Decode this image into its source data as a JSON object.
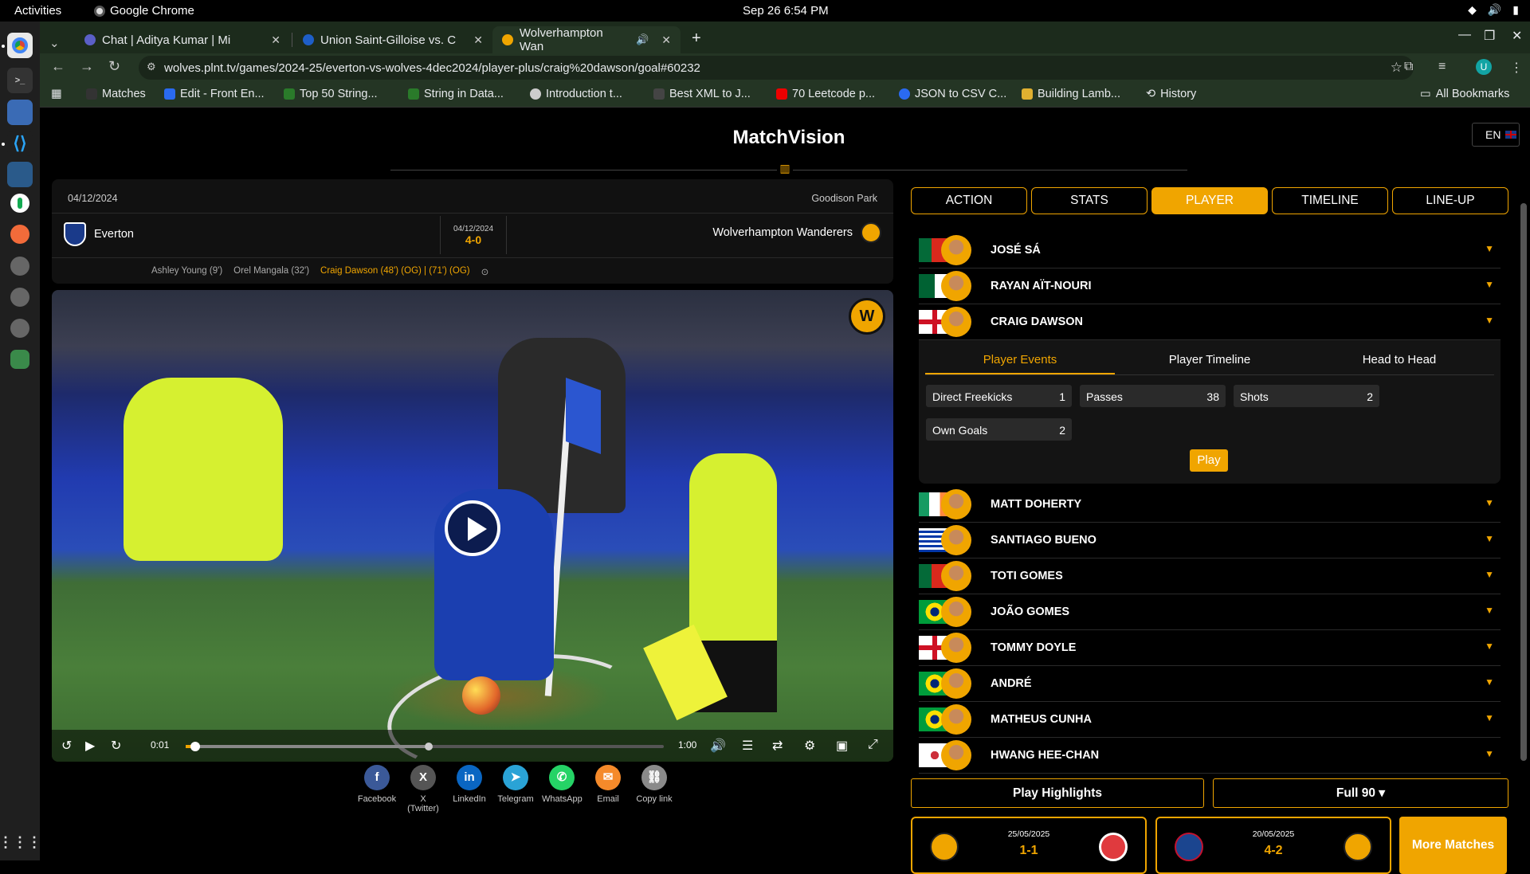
{
  "os": {
    "activities": "Activities",
    "app_name": "Google Chrome",
    "clock": "Sep 26  6:54 PM"
  },
  "browser": {
    "tabs": [
      {
        "label": "Chat | Aditya Kumar | Mi"
      },
      {
        "label": "Union Saint-Gilloise vs. C"
      },
      {
        "label": "Wolverhampton Wan"
      }
    ],
    "url": "wolves.plnt.tv/games/2024-25/everton-vs-wolves-4dec2024/player-plus/craig%20dawson/goal#60232",
    "profile_initial": "U",
    "bookmarks": [
      {
        "label": "Matches"
      },
      {
        "label": "Edit - Front En..."
      },
      {
        "label": "Top 50 String..."
      },
      {
        "label": "String in Data..."
      },
      {
        "label": "Introduction t..."
      },
      {
        "label": "Best XML to J..."
      },
      {
        "label": "70 Leetcode p..."
      },
      {
        "label": "JSON to CSV C..."
      },
      {
        "label": "Building Lamb..."
      },
      {
        "label": "History"
      }
    ],
    "all_bookmarks": "All Bookmarks"
  },
  "page": {
    "brand": "MatchVision",
    "lang": "EN"
  },
  "match": {
    "date": "04/12/2024",
    "venue": "Goodison Park",
    "home": "Everton",
    "away": "Wolverhampton Wanderers",
    "mid_date": "04/12/2024",
    "score": "4-0",
    "scorers": [
      "Ashley Young (9')",
      "Orel Mangala (32')",
      "Craig Dawson (48') (OG) | (71') (OG)"
    ]
  },
  "video": {
    "current_time": "0:01",
    "duration": "1:00",
    "progress": 0.02,
    "buffered": 0.5
  },
  "share": [
    {
      "label": "Facebook",
      "glyph": "f",
      "color": "#3b5998"
    },
    {
      "label": "X (Twitter)",
      "glyph": "X",
      "color": "#555555"
    },
    {
      "label": "LinkedIn",
      "glyph": "in",
      "color": "#0a66c2"
    },
    {
      "label": "Telegram",
      "glyph": "➤",
      "color": "#2aa3d6"
    },
    {
      "label": "WhatsApp",
      "glyph": "✆",
      "color": "#25d366"
    },
    {
      "label": "Email",
      "glyph": "✉",
      "color": "#f58a2a"
    },
    {
      "label": "Copy link",
      "glyph": "⛓",
      "color": "#8a8a8a"
    }
  ],
  "tabs": [
    "ACTION",
    "STATS",
    "PLAYER",
    "TIMELINE",
    "LINE-UP"
  ],
  "players_top": [
    {
      "name": "JOSÉ SÁ",
      "flag": "portugal"
    },
    {
      "name": "RAYAN AÏT-NOURI",
      "flag": "algeria"
    },
    {
      "name": "CRAIG DAWSON",
      "flag": "england"
    }
  ],
  "players_bottom": [
    {
      "name": "MATT DOHERTY",
      "flag": "ireland"
    },
    {
      "name": "SANTIAGO BUENO",
      "flag": "uruguay"
    },
    {
      "name": "TOTI GOMES",
      "flag": "portugal"
    },
    {
      "name": "JOÃO GOMES",
      "flag": "brazil"
    },
    {
      "name": "TOMMY DOYLE",
      "flag": "england"
    },
    {
      "name": "ANDRÉ",
      "flag": "brazil"
    },
    {
      "name": "MATHEUS CUNHA",
      "flag": "brazil"
    },
    {
      "name": "HWANG HEE-CHAN",
      "flag": "korea"
    }
  ],
  "detail": {
    "subtabs": [
      "Player Events",
      "Player Timeline",
      "Head to Head"
    ],
    "stats": [
      {
        "label": "Direct Freekicks",
        "value": "1"
      },
      {
        "label": "Passes",
        "value": "38"
      },
      {
        "label": "Shots",
        "value": "2"
      },
      {
        "label": "Own Goals",
        "value": "2"
      }
    ],
    "play": "Play"
  },
  "bottom": {
    "play_highlights": "Play Highlights",
    "full90": "Full 90 ▾",
    "more": "More Matches",
    "matches": [
      {
        "date": "25/05/2025",
        "score": "1-1"
      },
      {
        "date": "20/05/2025",
        "score": "4-2"
      }
    ]
  },
  "colors": {
    "accent": "#f0a500"
  }
}
